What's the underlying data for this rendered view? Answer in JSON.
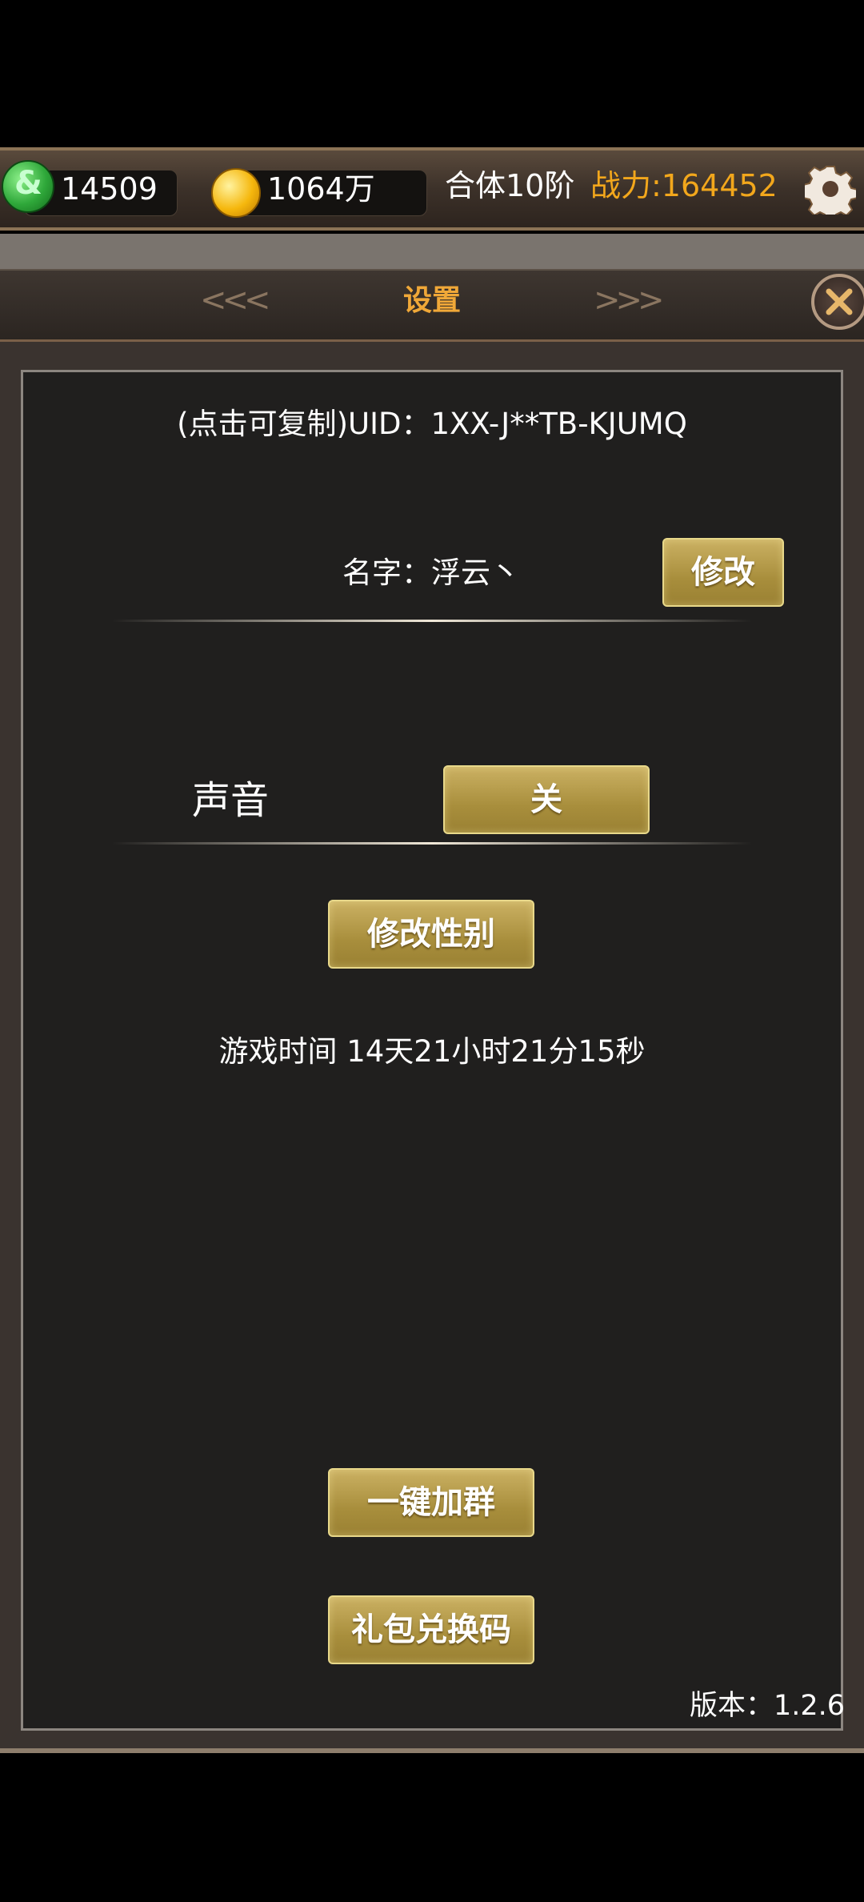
{
  "resources": {
    "jade": "14509",
    "gold": "1064万",
    "stage": "合体10阶",
    "power": "战力:164452"
  },
  "panel": {
    "title": "设置",
    "uid": "(点击可复制)UID：1XX-J**TB-KJUMQ",
    "name": "名字：浮云丶",
    "modify_label": "修改",
    "sound_label": "声音",
    "sound_value": "关",
    "gender_label": "修改性别",
    "playtime": "游戏时间 14天21小时21分15秒",
    "join_group_label": "一键加群",
    "gift_code_label": "礼包兑换码",
    "version": "版本：1.2.6"
  },
  "colors": {
    "accent_gold": "#f0a838",
    "power_orange": "#f2a71c",
    "button_gold": "#a88e3c",
    "panel_bg": "#201f1e"
  },
  "icons": {
    "jade": "jade-icon",
    "gold": "gold-coin-icon",
    "settings": "gear-icon",
    "close": "close-icon"
  }
}
